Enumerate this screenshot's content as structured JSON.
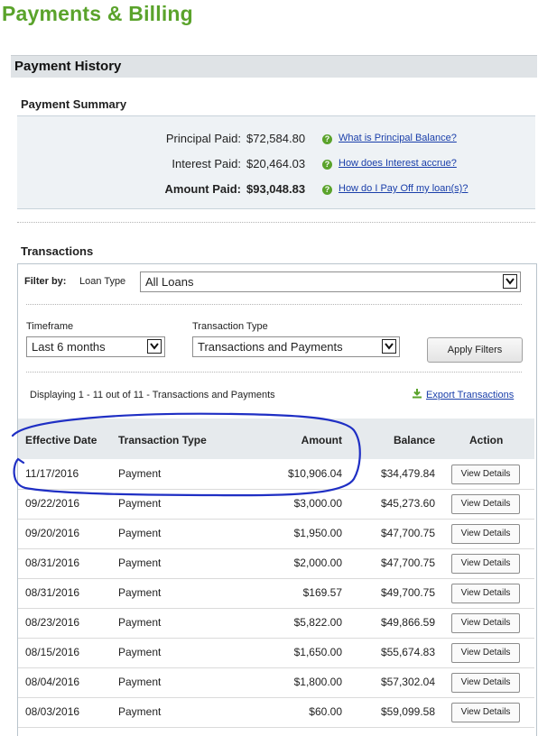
{
  "page_title": "Payments & Billing",
  "section_title": "Payment History",
  "summary": {
    "title": "Payment Summary",
    "rows": [
      {
        "label": "Principal Paid:",
        "value": "$72,584.80",
        "link": "What is Principal Balance?",
        "bold": false
      },
      {
        "label": "Interest Paid:",
        "value": "$20,464.03",
        "link": "How does Interest accrue?",
        "bold": false
      },
      {
        "label": "Amount Paid:",
        "value": "$93,048.83",
        "link": "How do I Pay Off my loan(s)?",
        "bold": true
      }
    ]
  },
  "transactions": {
    "title": "Transactions",
    "filter_by_label": "Filter by:",
    "loan_type_label": "Loan Type",
    "loan_type_value": "All Loans",
    "timeframe_label": "Timeframe",
    "timeframe_value": "Last 6 months",
    "transaction_type_label": "Transaction Type",
    "transaction_type_value": "Transactions and Payments",
    "apply_label": "Apply Filters",
    "display_text": "Displaying 1 - 11 out of 11 - Transactions and Payments",
    "export_label": "Export Transactions",
    "columns": {
      "date": "Effective Date",
      "type": "Transaction Type",
      "amount": "Amount",
      "balance": "Balance",
      "action": "Action"
    },
    "rows": [
      {
        "date": "11/17/2016",
        "type": "Payment",
        "amount": "$10,906.04",
        "balance": "$34,479.84",
        "action": "View Details"
      },
      {
        "date": "09/22/2016",
        "type": "Payment",
        "amount": "$3,000.00",
        "balance": "$45,273.60",
        "action": "View Details"
      },
      {
        "date": "09/20/2016",
        "type": "Payment",
        "amount": "$1,950.00",
        "balance": "$47,700.75",
        "action": "View Details"
      },
      {
        "date": "08/31/2016",
        "type": "Payment",
        "amount": "$2,000.00",
        "balance": "$47,700.75",
        "action": "View Details"
      },
      {
        "date": "08/31/2016",
        "type": "Payment",
        "amount": "$169.57",
        "balance": "$49,700.75",
        "action": "View Details"
      },
      {
        "date": "08/23/2016",
        "type": "Payment",
        "amount": "$5,822.00",
        "balance": "$49,866.59",
        "action": "View Details"
      },
      {
        "date": "08/15/2016",
        "type": "Payment",
        "amount": "$1,650.00",
        "balance": "$55,674.83",
        "action": "View Details"
      },
      {
        "date": "08/04/2016",
        "type": "Payment",
        "amount": "$1,800.00",
        "balance": "$57,302.04",
        "action": "View Details"
      },
      {
        "date": "08/03/2016",
        "type": "Payment",
        "amount": "$60.00",
        "balance": "$59,099.58",
        "action": "View Details"
      }
    ]
  },
  "colors": {
    "brand_green": "#5aa32b",
    "link_blue": "#1a3faa",
    "annotation_blue": "#1f2fc4"
  }
}
